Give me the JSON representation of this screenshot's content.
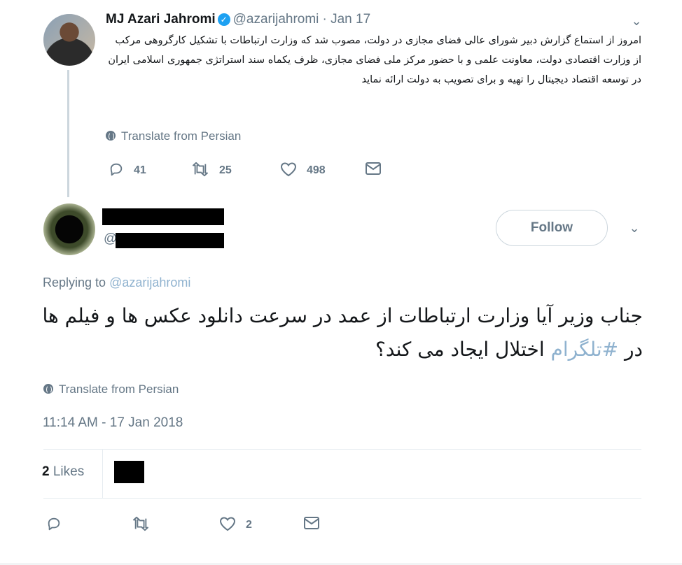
{
  "parent_tweet": {
    "author_name": "MJ Azari Jahromi",
    "handle": "@azarijahromi",
    "date": "· Jan 17",
    "text": "امروز از استماع گزارش دبیر شورای عالی فضای مجازی در دولت، مصوب شد که وزارت ارتباطات با تشکیل کارگروهی مرکب از وزارت اقتصادی دولت، معاونت علمی و با حضور مرکز ملی فضای مجازی، ظرف یکماه سند استراتژی جمهوری اسلامی ایران در توسعه اقتصاد دیجیتال را تهیه و برای تصویب به دولت ارائه نماید",
    "translate_label": "Translate from Persian",
    "reply_count": "41",
    "retweet_count": "25",
    "like_count": "498"
  },
  "main_tweet": {
    "handle_prefix": "@",
    "follow_label": "Follow",
    "replying_prefix": "Replying to ",
    "replying_mention": "@azarijahromi",
    "text_part1": "جناب وزیر آیا وزارت ارتباطات از عمد در سرعت دانلود عکس ها و فیلم ها در ",
    "hashtag": "#تلگرام",
    "text_part2": " اختلال ایجاد می کند؟",
    "translate_label": "Translate from Persian",
    "timestamp": "11:14 AM - 17 Jan 2018",
    "likes_number": "2",
    "likes_label": " Likes",
    "like_count": "2"
  },
  "colors": {
    "text": "#14171a",
    "secondary": "#657786",
    "link": "#8fb2cf",
    "verified": "#1da1f2",
    "divider": "#e6ecf0"
  },
  "icons": [
    "verified-icon",
    "chevron-down-icon",
    "globe-icon",
    "reply-icon",
    "retweet-icon",
    "heart-icon",
    "envelope-icon"
  ]
}
